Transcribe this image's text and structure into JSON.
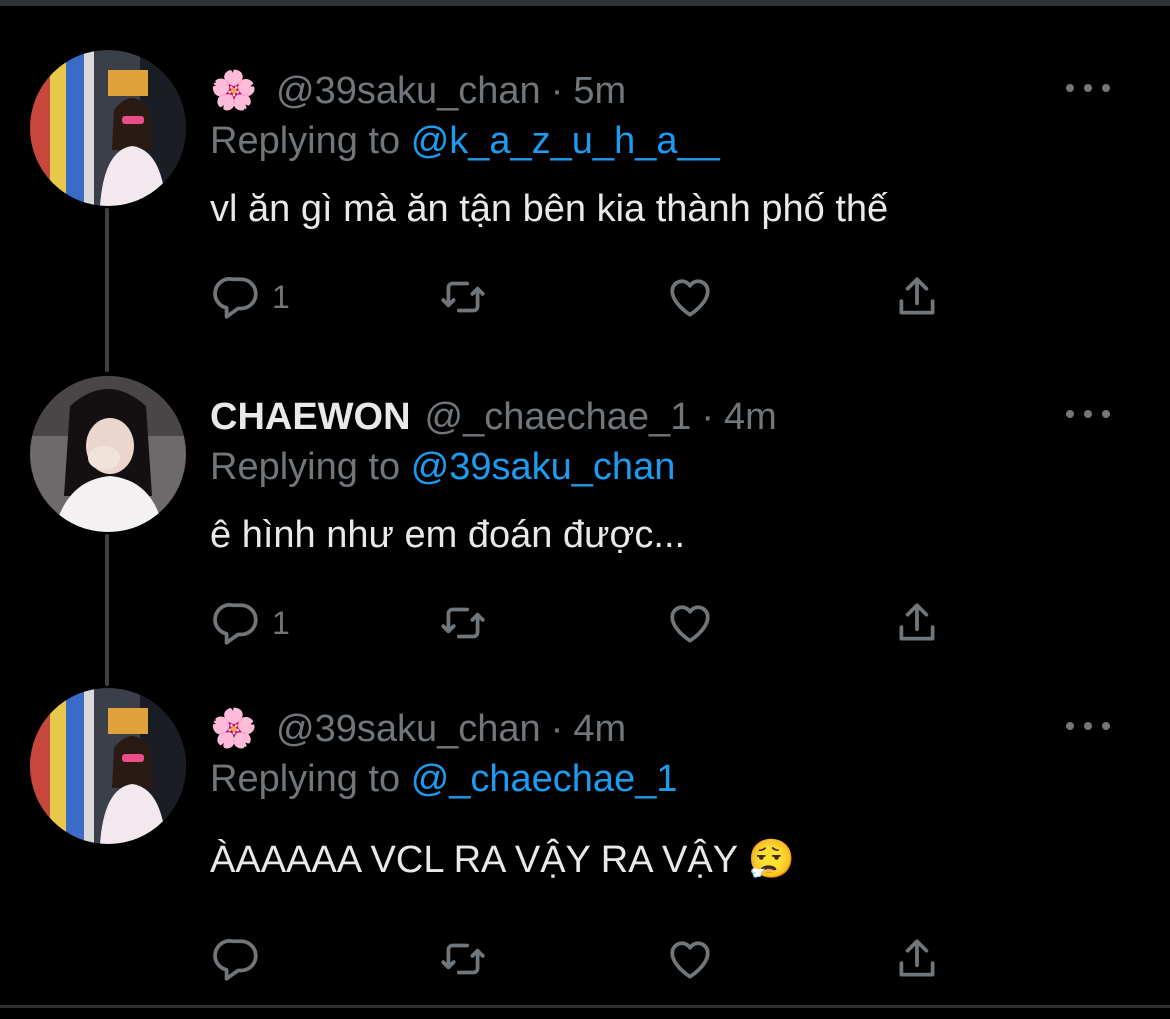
{
  "tweets": [
    {
      "emoji": "🌸",
      "display_name": "",
      "handle": "@39saku_chan",
      "separator": "·",
      "time": "5m",
      "reply_prefix": "Replying to",
      "reply_to": "@k_a_z_u_h_a__",
      "text": "vl ăn gì mà ăn tận bên kia thành phố thế",
      "reply_count": "1"
    },
    {
      "emoji": "",
      "display_name": "CHAEWON",
      "handle": "@_chaechae_1",
      "separator": "·",
      "time": "4m",
      "reply_prefix": "Replying to",
      "reply_to": "@39saku_chan",
      "text": "ê hình như em đoán được...",
      "reply_count": "1"
    },
    {
      "emoji": "🌸",
      "display_name": "",
      "handle": "@39saku_chan",
      "separator": "·",
      "time": "4m",
      "reply_prefix": "Replying to",
      "reply_to": "@_chaechae_1",
      "text": "ÀAAAAA VCL RA VẬY RA VẬY 😮‍💨",
      "reply_count": ""
    }
  ],
  "icons": {
    "more": "more-horizontal-icon",
    "reply": "reply-bubble-icon",
    "retweet": "retweet-icon",
    "like": "heart-icon",
    "share": "share-icon"
  },
  "colors": {
    "background": "#000000",
    "primary_text": "#e7e9ea",
    "secondary_text": "#71767b",
    "link": "#1d9bf0",
    "thread_line": "#3e4144"
  }
}
